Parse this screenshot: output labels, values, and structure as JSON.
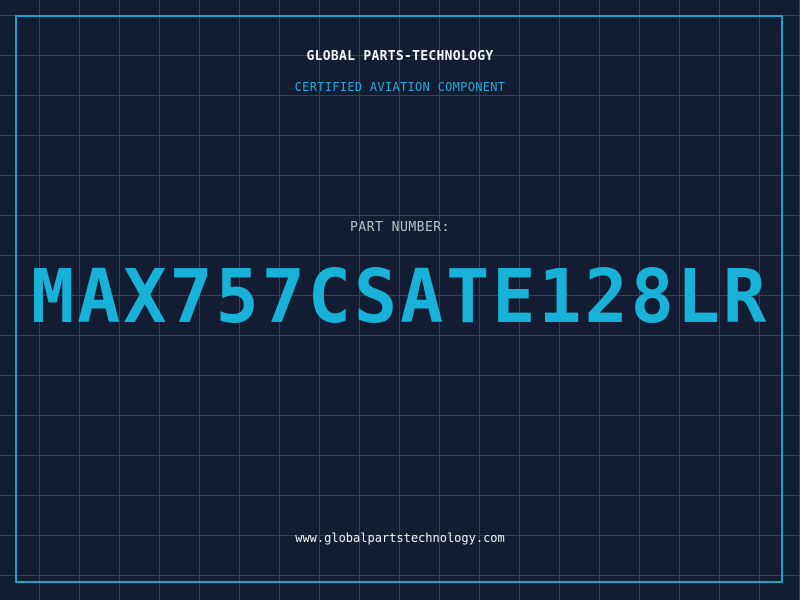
{
  "header": {
    "company": "GLOBAL PARTS-TECHNOLOGY",
    "subtitle": "CERTIFIED AVIATION COMPONENT"
  },
  "part": {
    "label": "PART NUMBER:",
    "number": "MAX757CSATE128LR"
  },
  "footer": {
    "url": "www.globalpartstechnology.com"
  },
  "colors": {
    "background": "#121c32",
    "grid": "#1f4a63",
    "accent": "#1fa2c7",
    "part_number": "#18b1d8",
    "heading": "#f2f5f8",
    "label": "#b9c2cc"
  }
}
